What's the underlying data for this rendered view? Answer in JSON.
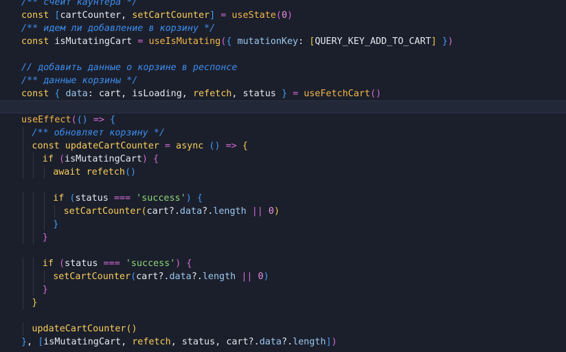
{
  "editor": {
    "theme_colors": {
      "background": "#1b1f2b",
      "keyword": "#f9ce5c",
      "comment": "#3d8ef0",
      "string": "#8fd77a",
      "number": "#e88fe0",
      "operator": "#d56ad7"
    },
    "active_line": 8,
    "lines": [
      {
        "indent": 0,
        "tokens": [
          [
            "cmt",
            "/** счеит каунтера */"
          ]
        ]
      },
      {
        "indent": 0,
        "tokens": [
          [
            "kw",
            "const "
          ],
          [
            "p3",
            "["
          ],
          [
            "id",
            "cartCounter, "
          ],
          [
            "fn",
            "setCartCounter"
          ],
          [
            "p3",
            "]"
          ],
          [
            "id",
            " "
          ],
          [
            "op",
            "="
          ],
          [
            "id",
            " "
          ],
          [
            "hook",
            "useState"
          ],
          [
            "p2",
            "("
          ],
          [
            "num",
            "0"
          ],
          [
            "p2",
            ")"
          ]
        ]
      },
      {
        "indent": 0,
        "tokens": [
          [
            "cmt",
            "/** идем ли добавление в корзину */"
          ]
        ]
      },
      {
        "indent": 0,
        "tokens": [
          [
            "kw",
            "const "
          ],
          [
            "id",
            "isMutatingCart "
          ],
          [
            "op",
            "="
          ],
          [
            "id",
            " "
          ],
          [
            "hook",
            "useIsMutating"
          ],
          [
            "p2",
            "("
          ],
          [
            "p3",
            "{ "
          ],
          [
            "prop",
            "mutationKey"
          ],
          [
            "id",
            ": "
          ],
          [
            "p1",
            "["
          ],
          [
            "const",
            "QUERY_KEY_ADD_TO_CART"
          ],
          [
            "p1",
            "]"
          ],
          [
            "p3",
            " }"
          ],
          [
            "p2",
            ")"
          ]
        ]
      },
      {
        "indent": 0,
        "tokens": []
      },
      {
        "indent": 0,
        "tokens": [
          [
            "cmt",
            "// добавить данные о корзине в респонсе"
          ]
        ]
      },
      {
        "indent": 0,
        "tokens": [
          [
            "cmt",
            "/** данные корзины */"
          ]
        ]
      },
      {
        "indent": 0,
        "tokens": [
          [
            "kw",
            "const "
          ],
          [
            "p3",
            "{ "
          ],
          [
            "prop",
            "data"
          ],
          [
            "id",
            ": cart, isLoading, "
          ],
          [
            "fn",
            "refetch"
          ],
          [
            "id",
            ", status "
          ],
          [
            "p3",
            "}"
          ],
          [
            "id",
            " "
          ],
          [
            "op",
            "="
          ],
          [
            "id",
            " "
          ],
          [
            "hook",
            "useFetchCart"
          ],
          [
            "p2",
            "()"
          ]
        ]
      },
      {
        "indent": 0,
        "tokens": []
      },
      {
        "indent": 0,
        "tokens": [
          [
            "hook",
            "useEffect"
          ],
          [
            "p2",
            "("
          ],
          [
            "p3",
            "()"
          ],
          [
            "id",
            " "
          ],
          [
            "op",
            "=>"
          ],
          [
            "id",
            " "
          ],
          [
            "p3",
            "{"
          ]
        ]
      },
      {
        "indent": 1,
        "tokens": [
          [
            "cmt",
            "/** обновляет корзину */"
          ]
        ]
      },
      {
        "indent": 1,
        "tokens": [
          [
            "kw",
            "const "
          ],
          [
            "fn",
            "updateCartCounter"
          ],
          [
            "id",
            " "
          ],
          [
            "op",
            "="
          ],
          [
            "id",
            " "
          ],
          [
            "kw",
            "async "
          ],
          [
            "p3",
            "()"
          ],
          [
            "id",
            " "
          ],
          [
            "op",
            "=>"
          ],
          [
            "id",
            " "
          ],
          [
            "p1",
            "{"
          ]
        ]
      },
      {
        "indent": 2,
        "tokens": [
          [
            "kw",
            "if "
          ],
          [
            "p2",
            "("
          ],
          [
            "id",
            "isMutatingCart"
          ],
          [
            "p2",
            ")"
          ],
          [
            "id",
            " "
          ],
          [
            "p2",
            "{"
          ]
        ]
      },
      {
        "indent": 3,
        "tokens": [
          [
            "kw",
            "await "
          ],
          [
            "fn",
            "refetch"
          ],
          [
            "p3",
            "()"
          ]
        ]
      },
      {
        "indent": 0,
        "tokens": []
      },
      {
        "indent": 3,
        "tokens": [
          [
            "kw",
            "if "
          ],
          [
            "p3",
            "("
          ],
          [
            "id",
            "status "
          ],
          [
            "op",
            "==="
          ],
          [
            "id",
            " "
          ],
          [
            "str",
            "'success'"
          ],
          [
            "p3",
            ")"
          ],
          [
            "id",
            " "
          ],
          [
            "p3",
            "{"
          ]
        ]
      },
      {
        "indent": 4,
        "tokens": [
          [
            "fn",
            "setCartCounter"
          ],
          [
            "p1",
            "("
          ],
          [
            "id",
            "cart?."
          ],
          [
            "prop",
            "data"
          ],
          [
            "id",
            "?."
          ],
          [
            "prop",
            "length"
          ],
          [
            "id",
            " "
          ],
          [
            "op",
            "||"
          ],
          [
            "id",
            " "
          ],
          [
            "num",
            "0"
          ],
          [
            "p1",
            ")"
          ]
        ]
      },
      {
        "indent": 3,
        "tokens": [
          [
            "p3",
            "}"
          ]
        ]
      },
      {
        "indent": 2,
        "tokens": [
          [
            "p2",
            "}"
          ]
        ]
      },
      {
        "indent": 0,
        "tokens": []
      },
      {
        "indent": 2,
        "tokens": [
          [
            "kw",
            "if "
          ],
          [
            "p2",
            "("
          ],
          [
            "id",
            "status "
          ],
          [
            "op",
            "==="
          ],
          [
            "id",
            " "
          ],
          [
            "str",
            "'success'"
          ],
          [
            "p2",
            ")"
          ],
          [
            "id",
            " "
          ],
          [
            "p2",
            "{"
          ]
        ]
      },
      {
        "indent": 3,
        "tokens": [
          [
            "fn",
            "setCartCounter"
          ],
          [
            "p3",
            "("
          ],
          [
            "id",
            "cart?."
          ],
          [
            "prop",
            "data"
          ],
          [
            "id",
            "?."
          ],
          [
            "prop",
            "length"
          ],
          [
            "id",
            " "
          ],
          [
            "op",
            "||"
          ],
          [
            "id",
            " "
          ],
          [
            "num",
            "0"
          ],
          [
            "p3",
            ")"
          ]
        ]
      },
      {
        "indent": 2,
        "tokens": [
          [
            "p2",
            "}"
          ]
        ]
      },
      {
        "indent": 1,
        "tokens": [
          [
            "p1",
            "}"
          ]
        ]
      },
      {
        "indent": 0,
        "tokens": []
      },
      {
        "indent": 1,
        "tokens": [
          [
            "fn",
            "updateCartCounter"
          ],
          [
            "p1",
            "()"
          ]
        ]
      },
      {
        "indent": 0,
        "tokens": [
          [
            "p3",
            "}"
          ],
          [
            "id",
            ", "
          ],
          [
            "p3",
            "["
          ],
          [
            "id",
            "isMutatingCart, "
          ],
          [
            "fn",
            "refetch"
          ],
          [
            "id",
            ", status, cart?."
          ],
          [
            "prop",
            "data"
          ],
          [
            "id",
            "?."
          ],
          [
            "prop",
            "length"
          ],
          [
            "p3",
            "]"
          ],
          [
            "p2",
            ")"
          ]
        ]
      }
    ]
  }
}
